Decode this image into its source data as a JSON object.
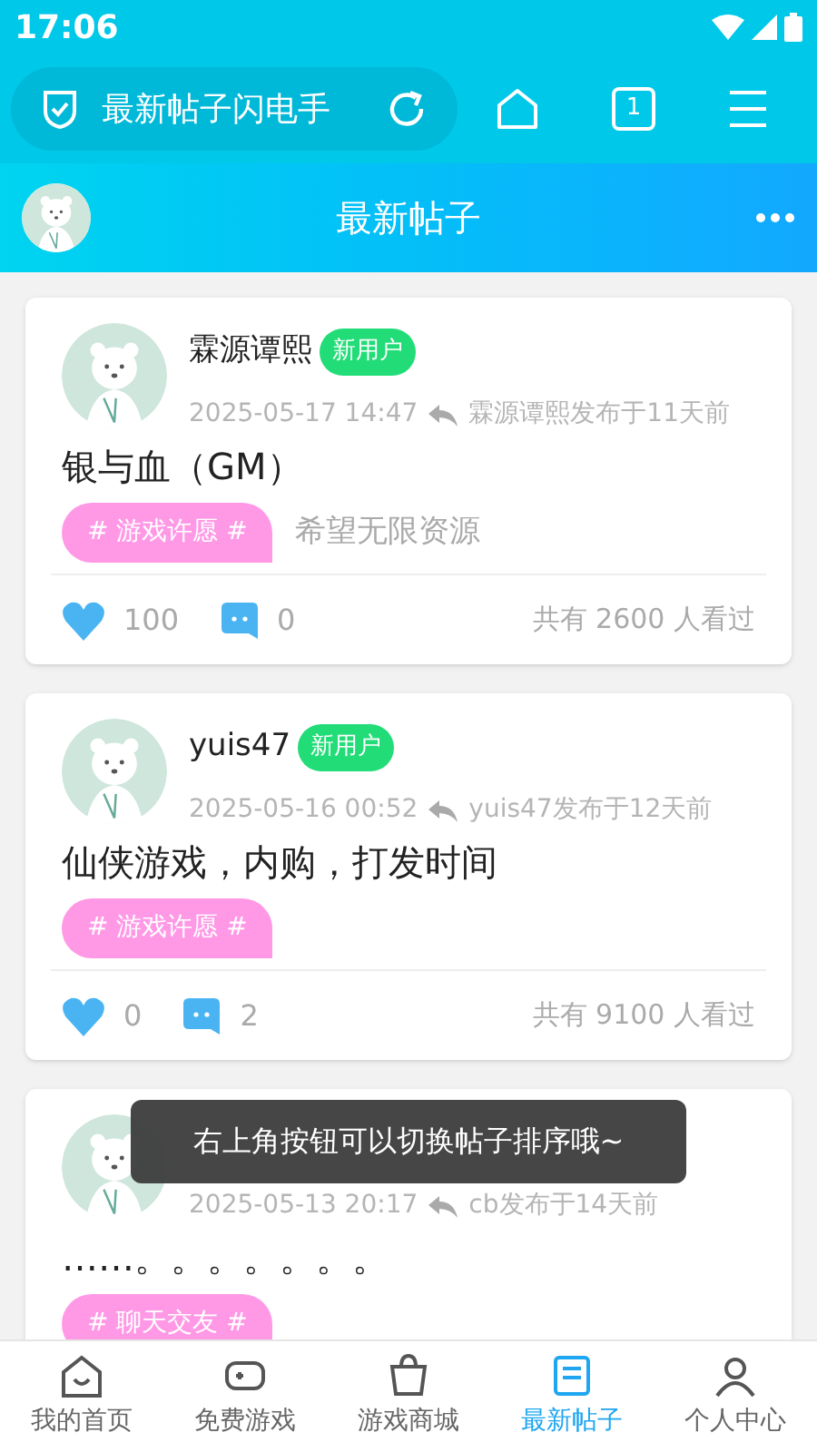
{
  "status_bar": {
    "time": "17:06"
  },
  "browser_bar": {
    "address": "最新帖子闪电手",
    "tab_count": "1"
  },
  "header": {
    "title": "最新帖子"
  },
  "posts": [
    {
      "name": "霖源谭熙",
      "badge": "新用户",
      "date": "2025-05-17 14:47",
      "author_note": "霖源谭熙发布于11天前",
      "title": "银与血（GM）",
      "tag": "# 游戏许愿 #",
      "description": "希望无限资源",
      "likes": "100",
      "comments": "0",
      "views": "共有 2600 人看过"
    },
    {
      "name": "yuis47",
      "badge": "新用户",
      "date": "2025-05-16 00:52",
      "author_note": "yuis47发布于12天前",
      "title": "仙侠游戏，内购，打发时间",
      "tag": "# 游戏许愿 #",
      "likes": "0",
      "comments": "2",
      "views": "共有 9100 人看过"
    },
    {
      "date": "2025-05-13 20:17",
      "author_note": "cb发布于14天前",
      "title": "……。。。。。。。",
      "tag": "# 聊天交友 #"
    }
  ],
  "toast": "右上角按钮可以切换帖子排序哦~",
  "nav": [
    {
      "label": "我的首页",
      "selected": false
    },
    {
      "label": "免费游戏",
      "selected": false
    },
    {
      "label": "游戏商城",
      "selected": false
    },
    {
      "label": "最新帖子",
      "selected": true
    },
    {
      "label": "个人中心",
      "selected": false
    }
  ]
}
